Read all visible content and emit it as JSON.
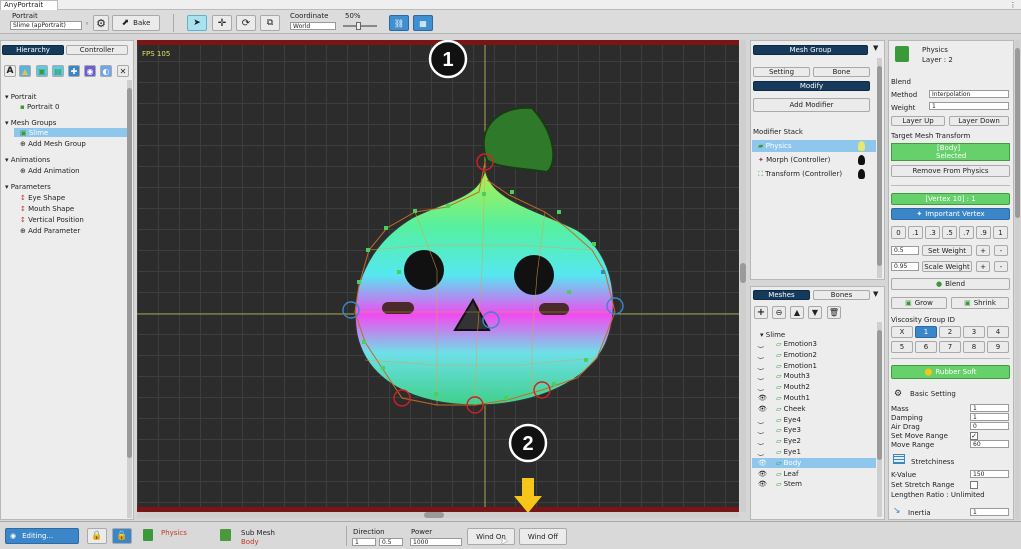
{
  "window": {
    "title": "AnyPortrait"
  },
  "toolbar": {
    "portrait_label": "Portrait",
    "portrait_value": "Slime (apPortrait)",
    "bake_label": "Bake",
    "coordinate_label": "Coordinate",
    "coordinate_value": "World",
    "zoom_value": "50%"
  },
  "hierarchy": {
    "tab_hierarchy": "Hierarchy",
    "tab_controller": "Controller",
    "sections": [
      {
        "title": "Portrait",
        "items": [
          "Portrait 0"
        ]
      },
      {
        "title": "Mesh Groups",
        "items": [
          "Slime",
          "Add Mesh Group"
        ]
      },
      {
        "title": "Animations",
        "items": [
          "Add Animation"
        ]
      },
      {
        "title": "Parameters",
        "items": [
          "Eye Shape",
          "Mouth Shape",
          "Vertical Position",
          "Add Parameter"
        ]
      }
    ]
  },
  "viewport": {
    "fps": "FPS 105",
    "badge1": "1",
    "badge2": "2"
  },
  "meshgroup": {
    "title": "Mesh Group",
    "tab_setting": "Setting",
    "tab_bone": "Bone",
    "tab_modify": "Modify",
    "add_modifier": "Add Modifier",
    "stack_title": "Modifier Stack",
    "stack": [
      "Physics",
      "Morph (Controller)",
      "Transform (Controller)"
    ]
  },
  "meshes": {
    "tab_meshes": "Meshes",
    "tab_bones": "Bones",
    "root": "Slime",
    "items": [
      "Emotion3",
      "Emotion2",
      "Emotion1",
      "Mouth3",
      "Mouth2",
      "Mouth1",
      "Cheek",
      "Eye4",
      "Eye3",
      "Eye2",
      "Eye1",
      "Body",
      "Leaf",
      "Stem"
    ]
  },
  "inspector": {
    "title": "Physics",
    "layer": "Layer : 2",
    "blend_label": "Blend",
    "method_label": "Method",
    "method_value": "Interpolation",
    "weight_label": "Weight",
    "weight_value": "1",
    "layer_up": "Layer Up",
    "layer_down": "Layer Down",
    "target_label": "Target Mesh Transform",
    "target_value": "[Body]",
    "target_state": "Selected",
    "remove_btn": "Remove From Physics",
    "vertex_info": "[Vertex 10] : 1",
    "important_vertex": "Important Vertex",
    "num_row": [
      "0",
      ".1",
      ".3",
      ".5",
      ".7",
      ".9",
      "1"
    ],
    "set_weight_value": "0.5",
    "set_weight": "Set Weight",
    "scale_weight_value": "0.95",
    "scale_weight": "Scale Weight",
    "plus": "+",
    "minus": "-",
    "blend_btn": "Blend",
    "grow": "Grow",
    "shrink": "Shrink",
    "viscosity_label": "Viscosity Group ID",
    "viscosity_row1": [
      "X",
      "1",
      "2",
      "3",
      "4"
    ],
    "viscosity_row2": [
      "5",
      "6",
      "7",
      "8",
      "9"
    ],
    "preset_btn": "Rubber Soft",
    "basic_setting": "Basic Setting",
    "mass_label": "Mass",
    "mass_value": "1",
    "damping_label": "Damping",
    "damping_value": "1",
    "airdrag_label": "Air Drag",
    "airdrag_value": "0",
    "setmove_label": "Set Move Range",
    "moverange_label": "Move Range",
    "moverange_value": "60",
    "stretch_title": "Stretchiness",
    "kvalue_label": "K-Value",
    "kvalue_value": "150",
    "setstretch_label": "Set Stretch Range",
    "lengthen_label": "Lengthen Ratio : Unlimited",
    "inertia_label": "Inertia",
    "inertia_value": "1"
  },
  "status": {
    "editing": "Editing...",
    "physics_label": "Physics",
    "submesh_label": "Sub Mesh",
    "submesh_value": "Body",
    "direction_label": "Direction",
    "direction_x": "1",
    "direction_y": "0.5",
    "power_label": "Power",
    "power_value": "1000",
    "wind_on": "Wind On",
    "wind_off": "Wind Off"
  },
  "colors": {
    "accent": "#3a86c8",
    "green": "#66d06a",
    "dark_tab": "#153a5c",
    "viewport": "#2b2b2b"
  }
}
